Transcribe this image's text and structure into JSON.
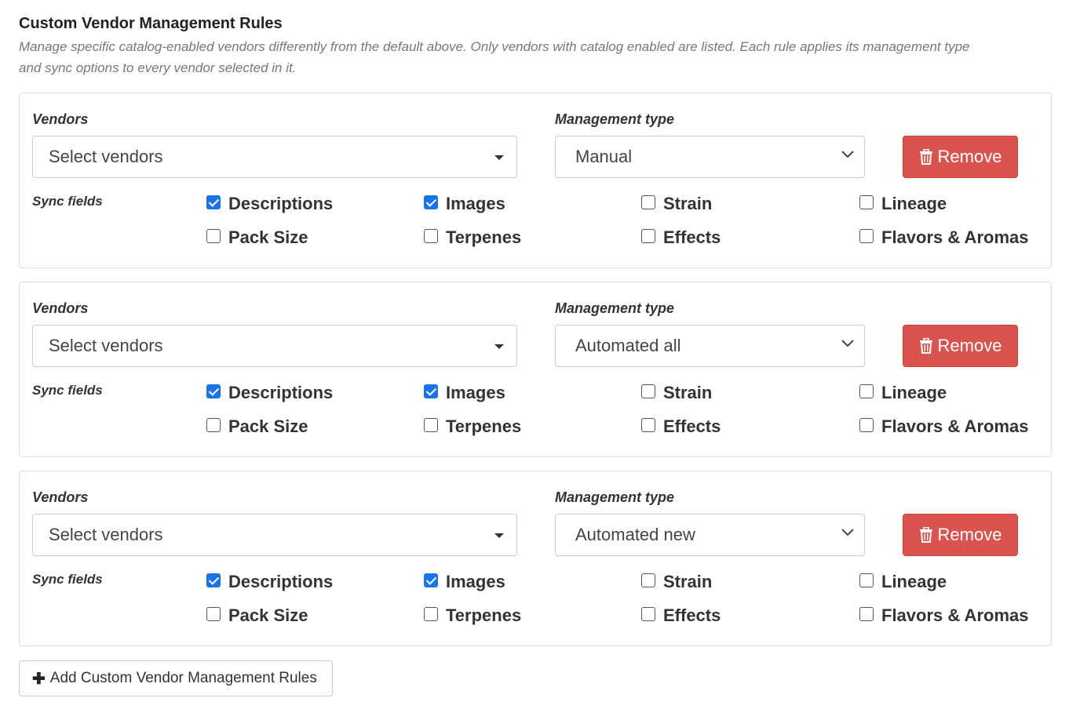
{
  "section": {
    "title": "Custom Vendor Management Rules",
    "description": "Manage specific catalog-enabled vendors differently from the default above. Only vendors with catalog enabled are listed. Each rule applies its management type and sync options to every vendor selected in it."
  },
  "labels": {
    "vendors": "Vendors",
    "management_type": "Management type",
    "sync_fields": "Sync fields",
    "remove": "Remove",
    "vendor_placeholder": "Select vendors"
  },
  "sync_field_names": {
    "descriptions": "Descriptions",
    "images": "Images",
    "strain": "Strain",
    "lineage": "Lineage",
    "pack_size": "Pack Size",
    "terpenes": "Terpenes",
    "effects": "Effects",
    "flavors_aromas": "Flavors & Aromas"
  },
  "rules": [
    {
      "management_type": "Manual",
      "checked": {
        "descriptions": true,
        "images": true,
        "strain": false,
        "lineage": false,
        "pack_size": false,
        "terpenes": false,
        "effects": false,
        "flavors_aromas": false
      }
    },
    {
      "management_type": "Automated all",
      "checked": {
        "descriptions": true,
        "images": true,
        "strain": false,
        "lineage": false,
        "pack_size": false,
        "terpenes": false,
        "effects": false,
        "flavors_aromas": false
      }
    },
    {
      "management_type": "Automated new",
      "checked": {
        "descriptions": true,
        "images": true,
        "strain": false,
        "lineage": false,
        "pack_size": false,
        "terpenes": false,
        "effects": false,
        "flavors_aromas": false
      }
    }
  ],
  "add_button": {
    "label": "Add Custom Vendor Management Rules"
  },
  "colors": {
    "remove_bg": "#d9534f",
    "checkbox_checked": "#1a73e8"
  }
}
